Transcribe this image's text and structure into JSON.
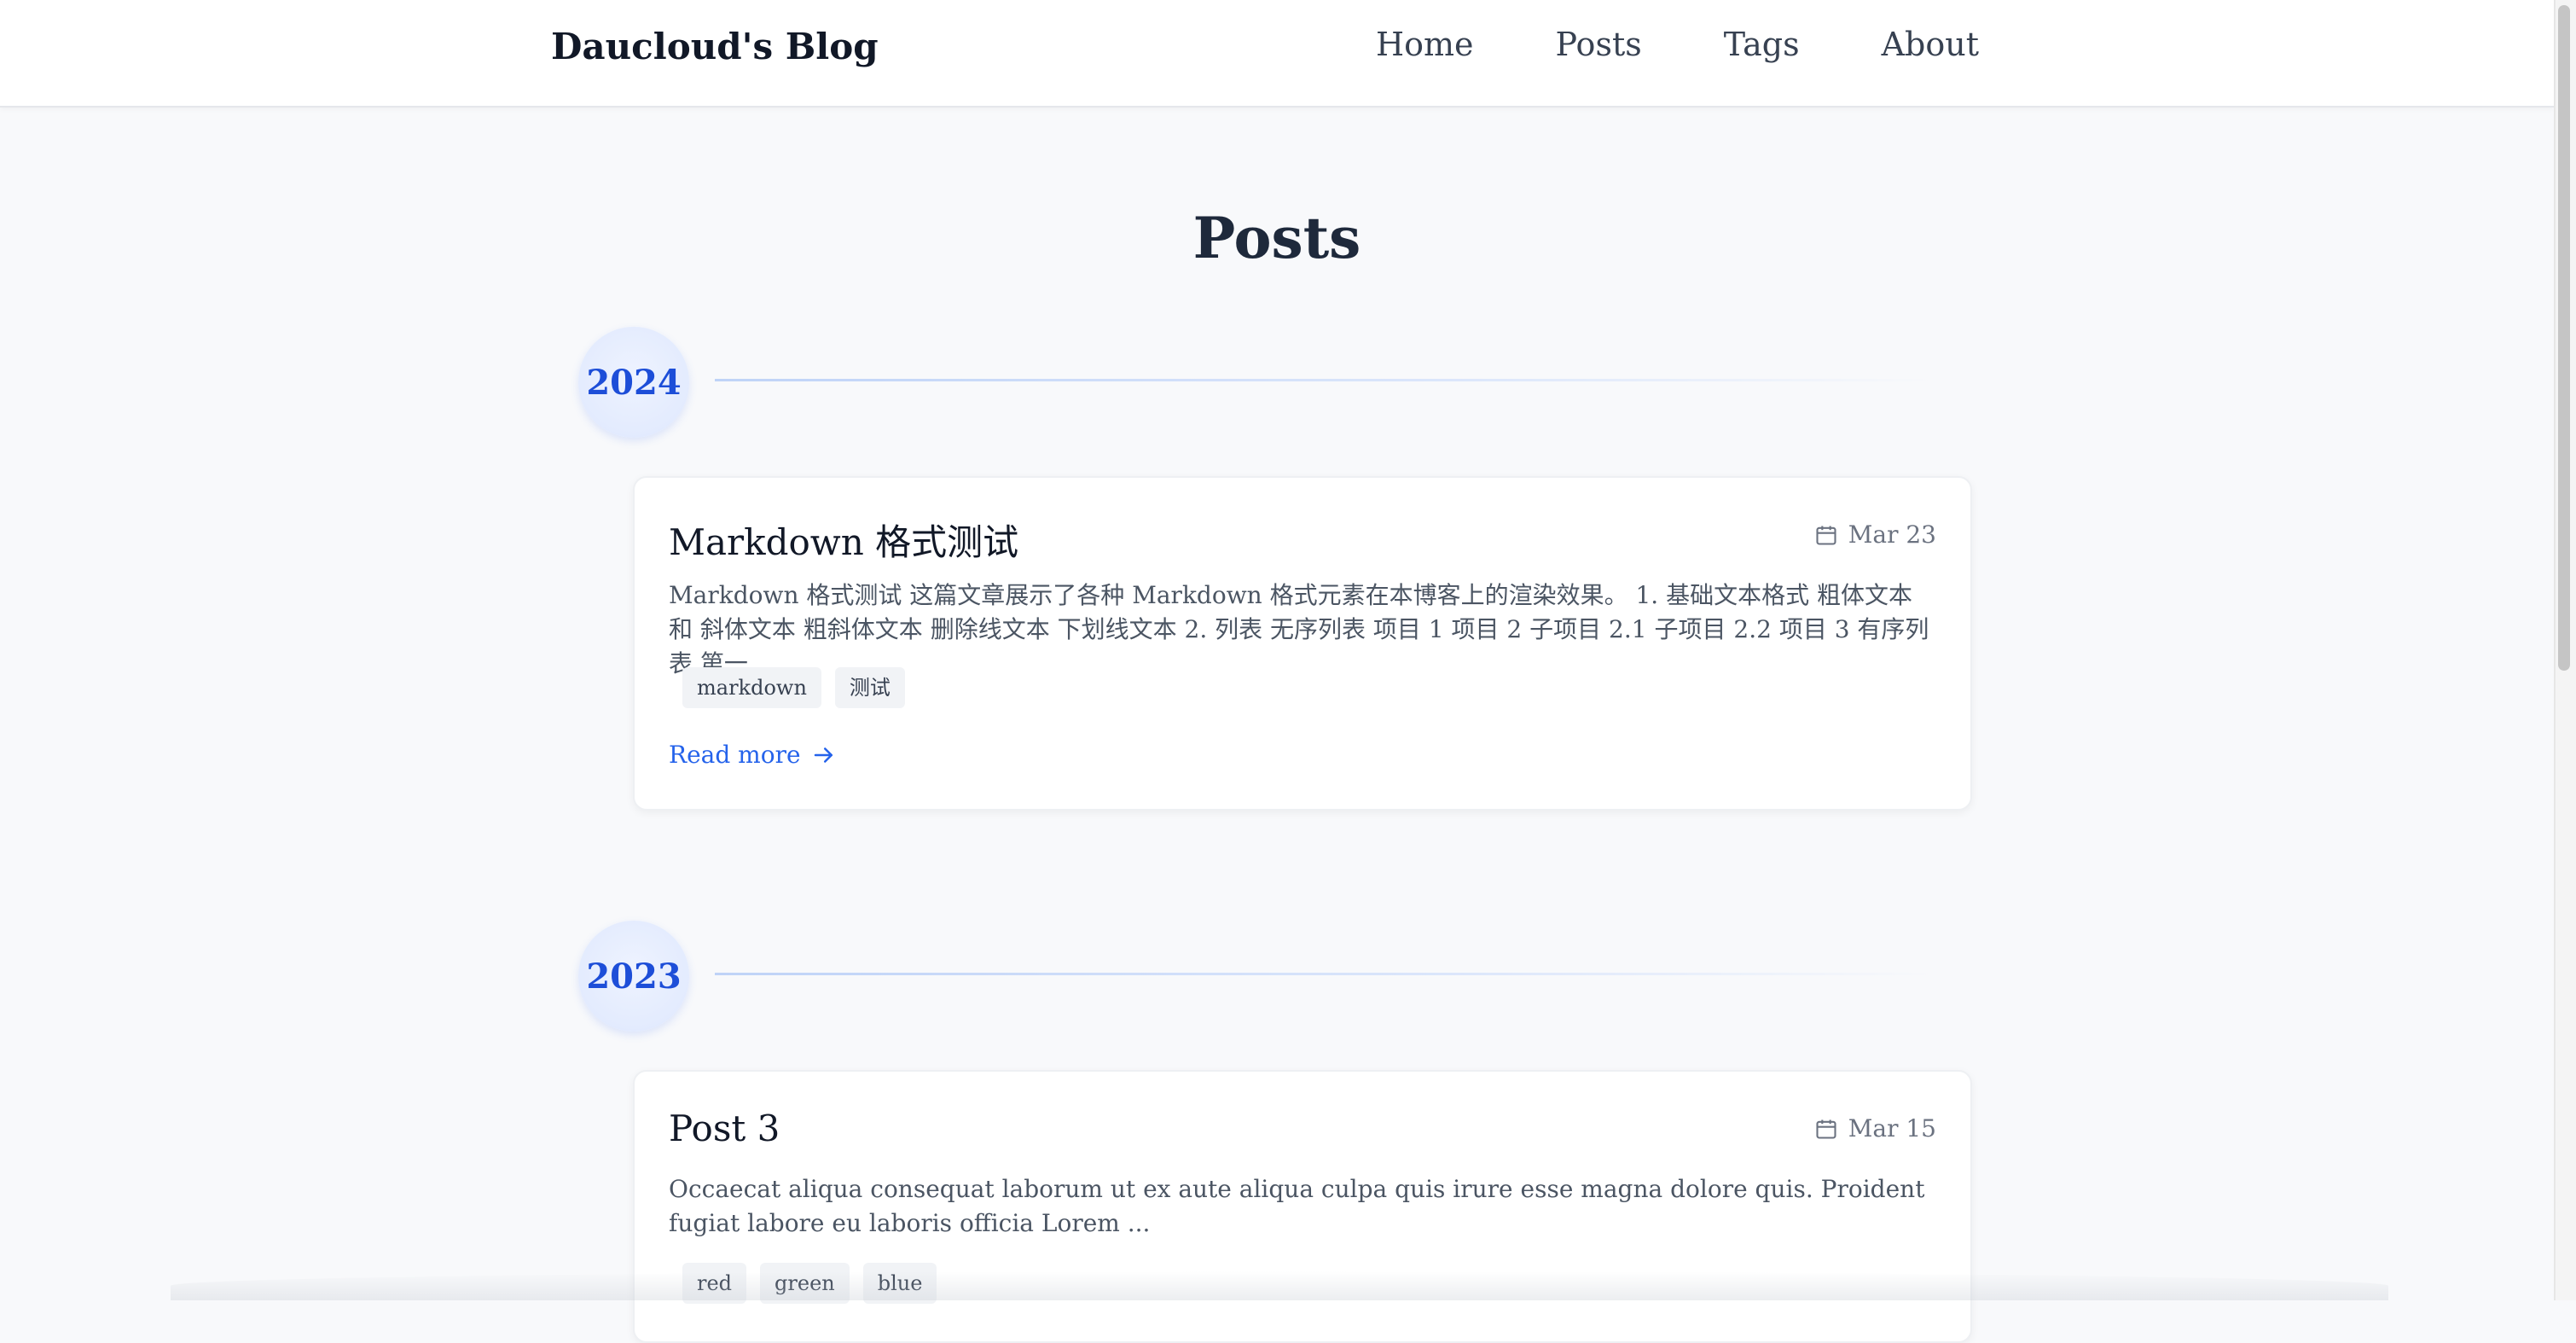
{
  "site": {
    "title": "Daucloud's Blog"
  },
  "nav": {
    "items": [
      "Home",
      "Posts",
      "Tags",
      "About"
    ]
  },
  "page": {
    "title": "Posts"
  },
  "groups": [
    {
      "year": "2024",
      "posts": [
        {
          "title": "Markdown 格式测试",
          "date": "Mar 23",
          "excerpt": "Markdown 格式测试 这篇文章展示了各种 Markdown 格式元素在本博客上的渲染效果。 1. 基础文本格式 粗体文本 和 斜体文本 粗斜体文本 删除线文本 下划线文本 2. 列表 无序列表 项目 1 项目 2 子项目 2.1 子项目 2.2 项目 3 有序列表 第一...",
          "tags": [
            "markdown",
            "测试"
          ],
          "read_more": "Read more"
        }
      ]
    },
    {
      "year": "2023",
      "posts": [
        {
          "title": "Post 3",
          "date": "Mar 15",
          "excerpt": "Occaecat aliqua consequat laborum ut ex aute aliqua culpa quis irure esse magna dolore quis. Proident fugiat labore eu laboris officia Lorem ...",
          "tags": [
            "red",
            "green",
            "blue"
          ]
        }
      ]
    }
  ],
  "theme": {
    "accent": "#2563eb",
    "year_text": "#1d4ed8",
    "background": "#f8f9fb",
    "card_background": "#ffffff"
  }
}
